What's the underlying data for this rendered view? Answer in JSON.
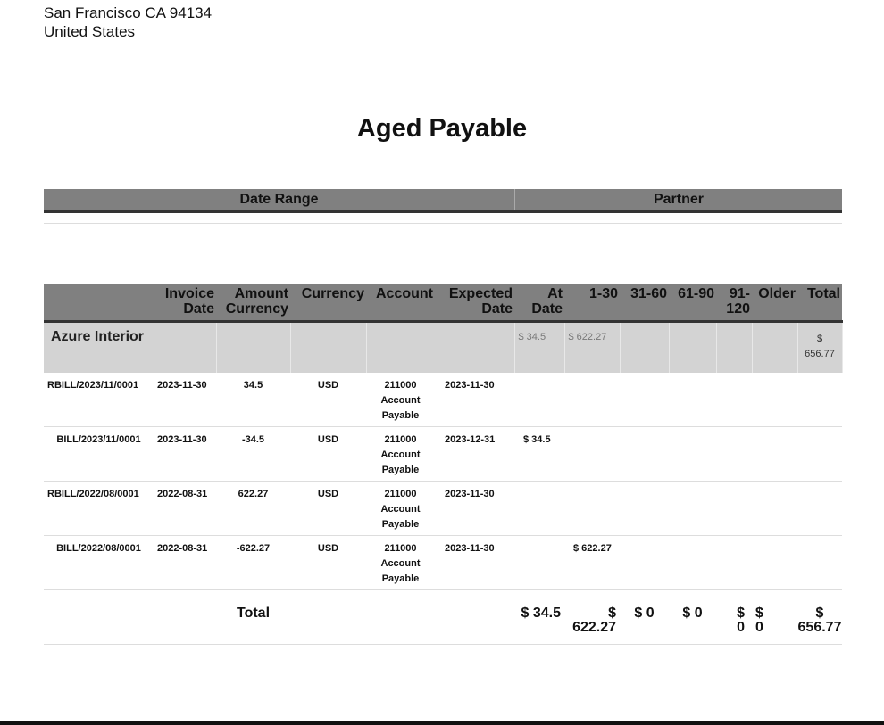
{
  "address": {
    "line1": "San Francisco CA 94134",
    "line2": "United States"
  },
  "title": "Aged Payable",
  "filters": {
    "headers": [
      "Date Range",
      "Partner"
    ]
  },
  "columns": [
    "",
    "Invoice Date",
    "Amount Currency",
    "Currency",
    "Account",
    "Expected Date",
    "At Date",
    "1-30",
    "31-60",
    "61-90",
    "91-120",
    "Older",
    "Total"
  ],
  "group": {
    "name": "Azure Interior",
    "at_date": "$ 34.5",
    "d1_30": "$ 622.27",
    "total": "$ 656.77"
  },
  "lines": [
    {
      "ref": "RBILL/2023/11/0001",
      "invoice_date": "2023-11-30",
      "amount": "34.5",
      "currency": "USD",
      "account": "211000 Account Payable",
      "expected": "2023-11-30",
      "at_date": "",
      "d1_30": ""
    },
    {
      "ref": "BILL/2023/11/0001",
      "invoice_date": "2023-11-30",
      "amount": "-34.5",
      "currency": "USD",
      "account": "211000 Account Payable",
      "expected": "2023-12-31",
      "at_date": "$ 34.5",
      "d1_30": ""
    },
    {
      "ref": "RBILL/2022/08/0001",
      "invoice_date": "2022-08-31",
      "amount": "622.27",
      "currency": "USD",
      "account": "211000 Account Payable",
      "expected": "2023-11-30",
      "at_date": "",
      "d1_30": ""
    },
    {
      "ref": "BILL/2022/08/0001",
      "invoice_date": "2022-08-31",
      "amount": "-622.27",
      "currency": "USD",
      "account": "211000 Account Payable",
      "expected": "2023-11-30",
      "at_date": "",
      "d1_30": "$ 622.27"
    }
  ],
  "totals": {
    "label": "Total",
    "at_date": "$ 34.5",
    "d1_30": "$ 622.27",
    "d31_60": "$ 0",
    "d61_90": "$ 0",
    "d91_120": "$ 0",
    "older": "$ 0",
    "total": "$ 656.77"
  }
}
